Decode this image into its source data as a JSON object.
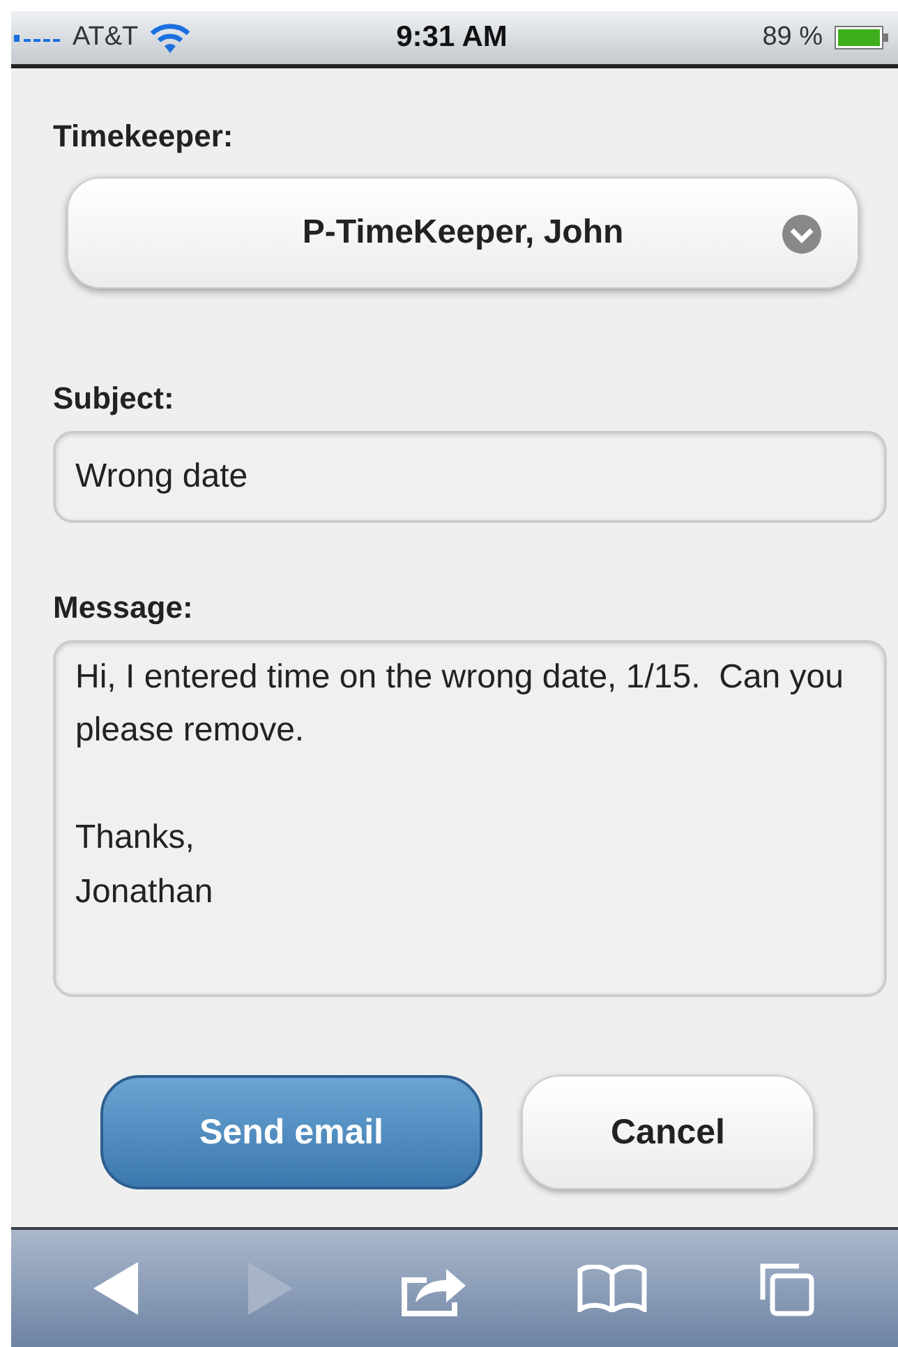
{
  "status_bar": {
    "carrier": "AT&T",
    "time": "9:31 AM",
    "battery": "89 %"
  },
  "timekeeper": {
    "label": "Timekeeper:",
    "value": "P-TimeKeeper, John"
  },
  "subject": {
    "label": "Subject:",
    "value": "Wrong date"
  },
  "message": {
    "label": "Message:",
    "value": "Hi, I entered time on the wrong date, 1/15.  Can you please remove.\n\nThanks,\nJonathan"
  },
  "buttons": [
    {
      "label": "Send email",
      "kind": "primary"
    },
    {
      "label": "Cancel",
      "kind": "secondary"
    }
  ],
  "toolbar": [
    {
      "kind": "back",
      "disabled": false
    },
    {
      "kind": "forward",
      "disabled": true
    },
    {
      "kind": "share",
      "disabled": false
    },
    {
      "kind": "bookmarks",
      "disabled": false
    },
    {
      "kind": "tabs",
      "disabled": false
    }
  ]
}
